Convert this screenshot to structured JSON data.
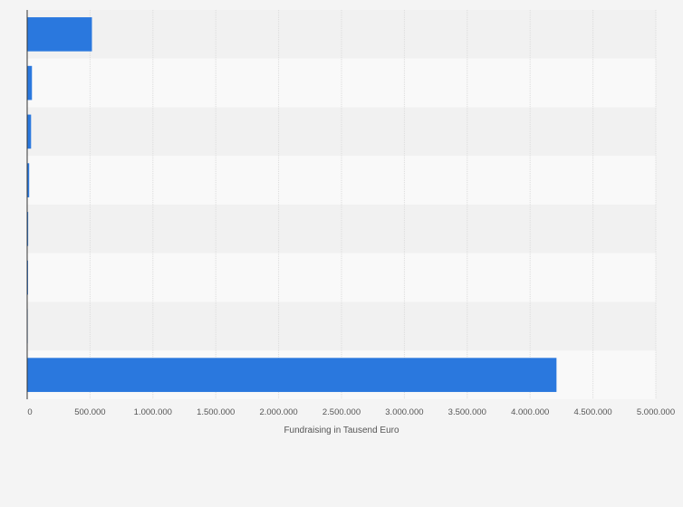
{
  "chart_data": {
    "type": "bar",
    "orientation": "horizontal",
    "categories": [
      "",
      "",
      "",
      "",
      "",
      "",
      "",
      ""
    ],
    "values": [
      515000,
      38000,
      31000,
      16000,
      8000,
      7000,
      1000,
      4210000
    ],
    "xlabel": "Fundraising in Tausend Euro",
    "ylabel": "",
    "xlim": [
      0,
      5000000
    ],
    "xticks": [
      0,
      500000,
      1000000,
      1500000,
      2000000,
      2500000,
      3000000,
      3500000,
      4000000,
      4500000,
      5000000
    ],
    "xtick_labels": [
      "0",
      "500.000",
      "1.000.000",
      "1.500.000",
      "2.000.000",
      "2.500.000",
      "3.000.000",
      "3.500.000",
      "4.000.000",
      "4.500.000",
      "5.000.000"
    ],
    "grid": true,
    "legend": "none"
  },
  "colors": {
    "bar": "#2a78de",
    "band_dark": "#f1f1f1",
    "band_light": "#f9f9f9",
    "grid": "#dcdcdc",
    "axis": "#333333"
  }
}
